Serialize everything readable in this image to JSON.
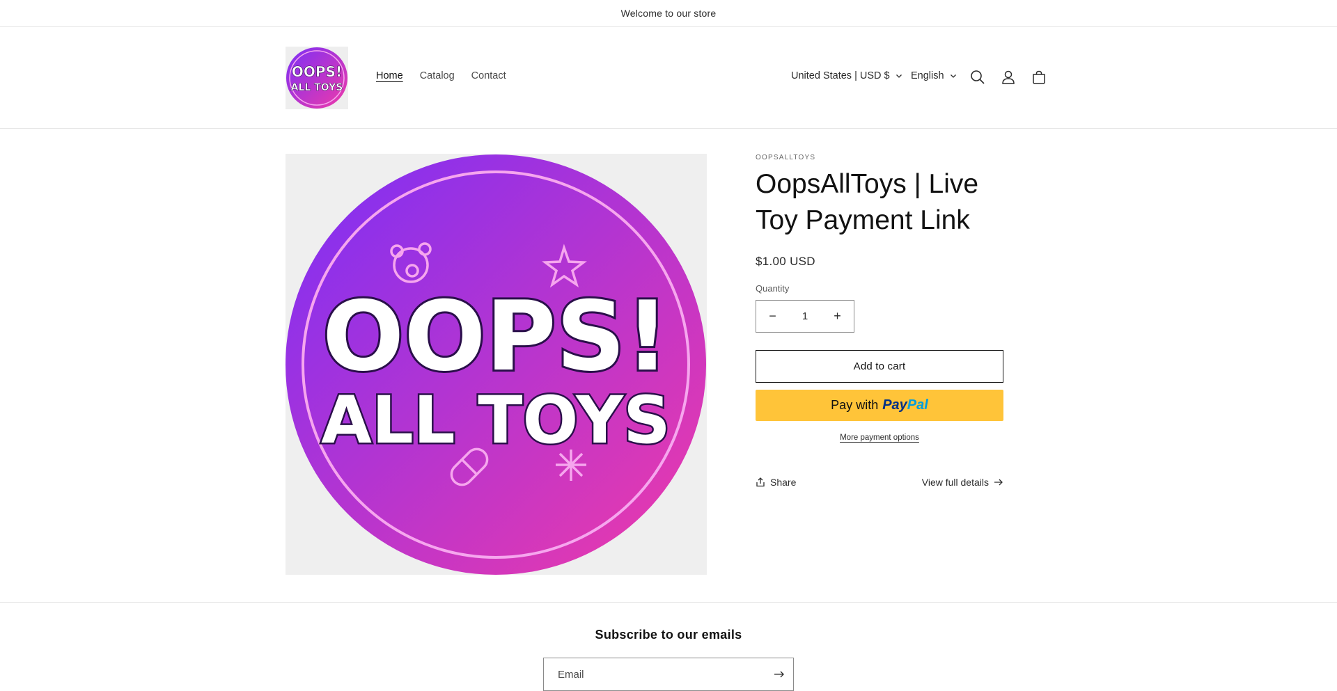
{
  "announcement": {
    "text": "Welcome to our store"
  },
  "header": {
    "logo_text_line1": "OOPS!",
    "logo_text_line2": "ALL TOYS",
    "nav": [
      {
        "label": "Home",
        "active": true
      },
      {
        "label": "Catalog",
        "active": false
      },
      {
        "label": "Contact",
        "active": false
      }
    ],
    "country_label": "United States | USD $",
    "language_label": "English"
  },
  "product": {
    "image_text_line1": "OOPS!",
    "image_text_line2": "ALL TOYS",
    "vendor": "OOPSALLTOYS",
    "title": "OopsAllToys | Live Toy Payment Link",
    "price": "$1.00 USD",
    "quantity_label": "Quantity",
    "quantity_value": "1",
    "decrease_label": "−",
    "increase_label": "+",
    "add_to_cart_label": "Add to cart",
    "paypal_prefix": "Pay with",
    "paypal_brand_1": "Pay",
    "paypal_brand_2": "Pal",
    "more_payment_options": "More payment options",
    "share_label": "Share",
    "view_details_label": "View full details"
  },
  "newsletter": {
    "title": "Subscribe to our emails",
    "email_placeholder": "Email"
  },
  "colors": {
    "gradient_start": "#7b2ff7",
    "gradient_end": "#f03aa8",
    "paypal_yellow": "#ffc439"
  }
}
